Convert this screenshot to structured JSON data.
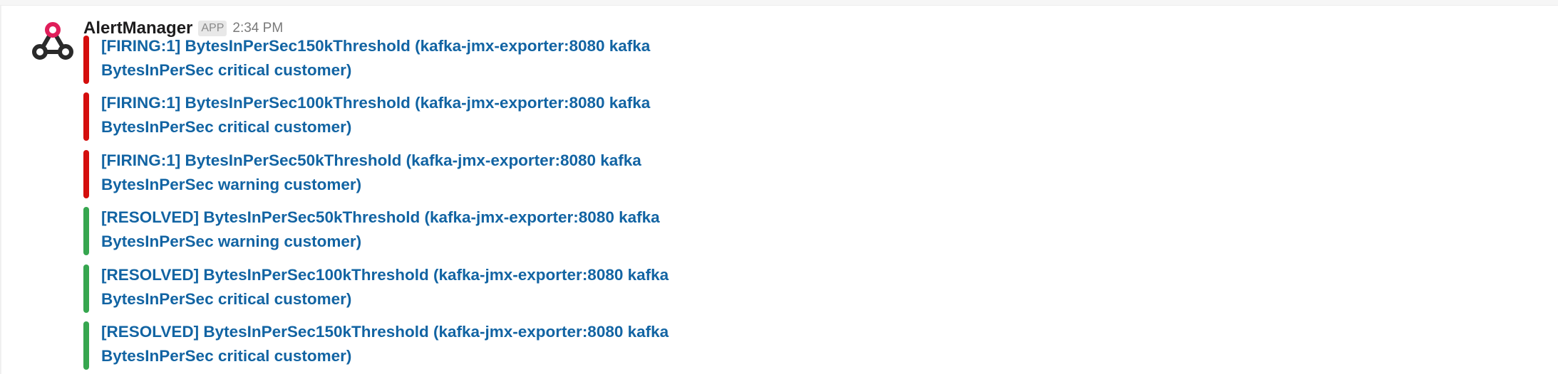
{
  "message": {
    "sender": "AlertManager",
    "badge": "APP",
    "timestamp": "2:34 PM",
    "avatar_icon": "webhook-icon",
    "avatar_color": "#2a2a2a",
    "avatar_accent": "#e01e5a"
  },
  "attachments": [
    {
      "status": "firing",
      "color": "#d40e0d",
      "line1": "[FIRING:1] BytesInPerSec150kThreshold (kafka-jmx-exporter:8080 kafka",
      "line2": "BytesInPerSec critical customer)"
    },
    {
      "status": "firing",
      "color": "#d40e0d",
      "line1": "[FIRING:1] BytesInPerSec100kThreshold (kafka-jmx-exporter:8080 kafka",
      "line2": "BytesInPerSec critical customer)"
    },
    {
      "status": "firing",
      "color": "#d40e0d",
      "line1": "[FIRING:1] BytesInPerSec50kThreshold (kafka-jmx-exporter:8080 kafka",
      "line2": "BytesInPerSec warning customer)"
    },
    {
      "status": "resolved",
      "color": "#36a64f",
      "line1": "[RESOLVED] BytesInPerSec50kThreshold (kafka-jmx-exporter:8080 kafka",
      "line2": "BytesInPerSec warning customer)"
    },
    {
      "status": "resolved",
      "color": "#36a64f",
      "line1": "[RESOLVED] BytesInPerSec100kThreshold (kafka-jmx-exporter:8080 kafka",
      "line2": "BytesInPerSec critical customer)"
    },
    {
      "status": "resolved",
      "color": "#36a64f",
      "line1": "[RESOLVED] BytesInPerSec150kThreshold (kafka-jmx-exporter:8080 kafka",
      "line2": "BytesInPerSec critical customer)"
    }
  ]
}
